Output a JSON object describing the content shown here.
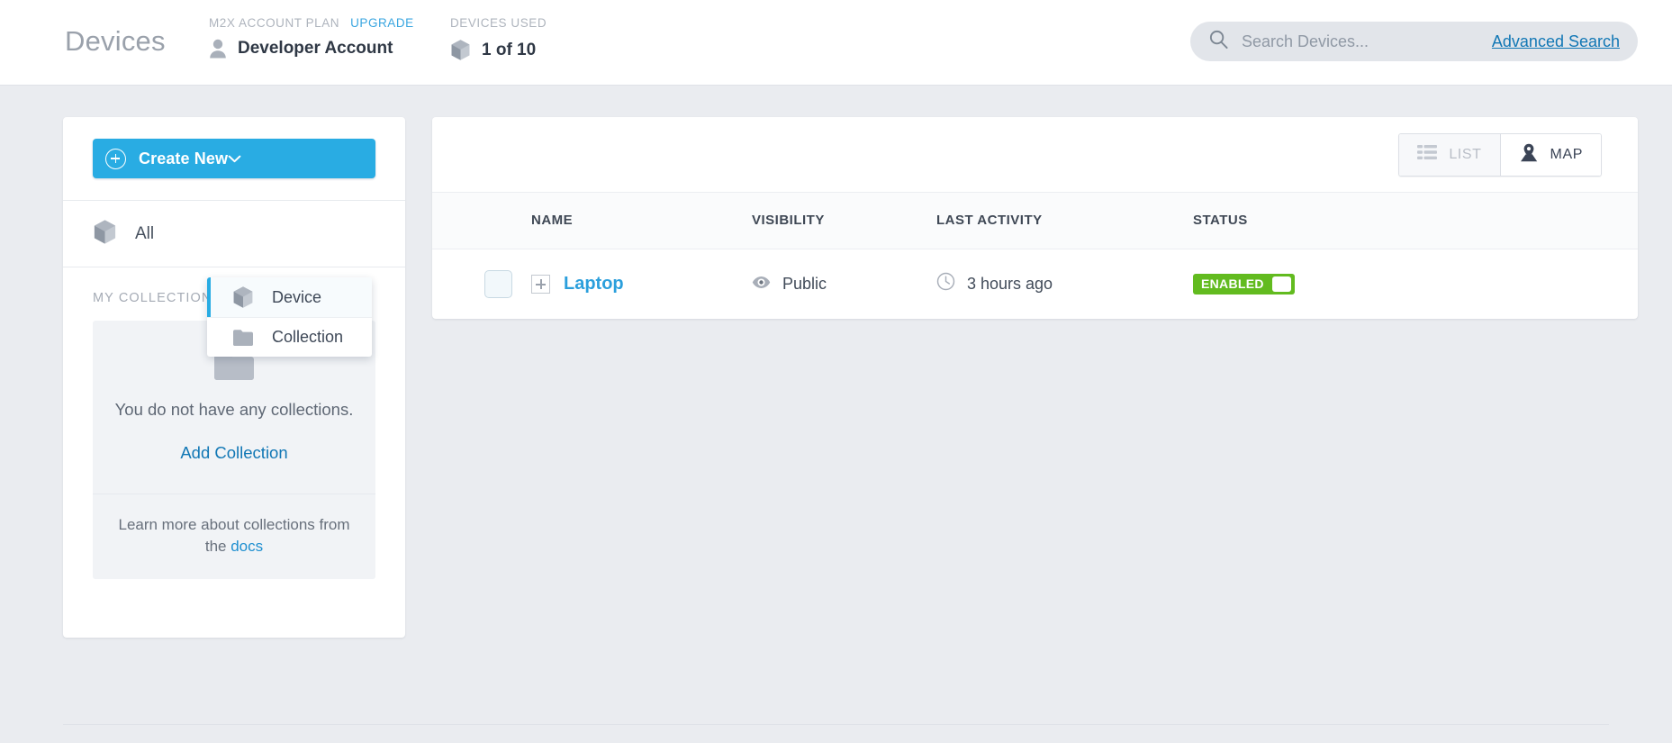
{
  "header": {
    "page_title": "Devices",
    "plan": {
      "label": "M2X ACCOUNT PLAN",
      "upgrade_label": "UPGRADE",
      "value": "Developer Account",
      "icon": "person-icon"
    },
    "devices_used": {
      "label": "DEVICES USED",
      "value": "1 of 10",
      "icon": "cube-icon"
    },
    "search": {
      "placeholder": "Search Devices...",
      "value": "",
      "icon": "search-icon",
      "advanced_label": "Advanced Search",
      "advanced_color": "#1177b5"
    }
  },
  "sidebar": {
    "create_button": {
      "label": "Create New",
      "icon": "plus-circle-icon",
      "chevron": "chevron-down-icon",
      "color": "#29ace3"
    },
    "dropdown": {
      "open": true,
      "items": [
        {
          "label": "Device",
          "icon": "cube-icon",
          "active": true
        },
        {
          "label": "Collection",
          "icon": "folder-icon",
          "active": false
        }
      ],
      "accent_color": "#29ace3"
    },
    "all_row": {
      "label": "All",
      "icon": "cube-icon"
    },
    "collections": {
      "section_title": "MY COLLECTIONS",
      "empty_icon": "folder-icon",
      "empty_text": "You do not have any collections.",
      "add_link": "Add Collection",
      "docs_note_prefix": "Learn more about collections from the ",
      "docs_link": "docs"
    }
  },
  "main": {
    "view_toggle": [
      {
        "label": "LIST",
        "icon": "list-icon",
        "active": false
      },
      {
        "label": "MAP",
        "icon": "map-pin-icon",
        "active": true
      }
    ],
    "table": {
      "columns": [
        "",
        "NAME",
        "VISIBILITY",
        "LAST ACTIVITY",
        "STATUS"
      ],
      "rows": [
        {
          "checked": false,
          "expand_icon": "plus-box-icon",
          "name": "Laptop",
          "visibility": "Public",
          "visibility_icon": "eye-icon",
          "last_activity": "3 hours ago",
          "last_activity_icon": "clock-icon",
          "status": "ENABLED",
          "status_color": "#62bb1f"
        }
      ]
    }
  }
}
